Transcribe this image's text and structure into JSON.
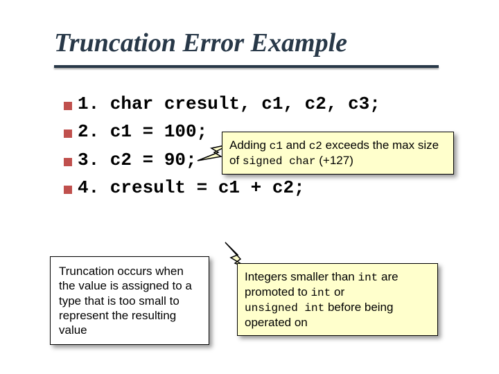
{
  "title": "Truncation Error Example",
  "code": {
    "l1": "1. char cresult, c1, c2, c3;",
    "l2": "2. c1 = 100;",
    "l3": "3. c2 = 90;",
    "l4": "4. cresult = c1 + c2;"
  },
  "callout_top": {
    "p1a": "Adding ",
    "c1": "c1",
    "p1b": " and ",
    "c2": "c2",
    "p1c": " exceeds the max size",
    "p2a": "of ",
    "code2": "signed char",
    "p2b": " (+127)"
  },
  "note_left": "Truncation occurs when the value is assigned to a type that is too small to represent the resulting value",
  "callout_br": {
    "p1a": "Integers smaller than ",
    "int1": "int",
    "p1b": " are",
    "p2a": "promoted to ",
    "int2": "int",
    "p2b": " or",
    "p3code": "unsigned int",
    "p3b": " before being",
    "p4": "operated on"
  }
}
